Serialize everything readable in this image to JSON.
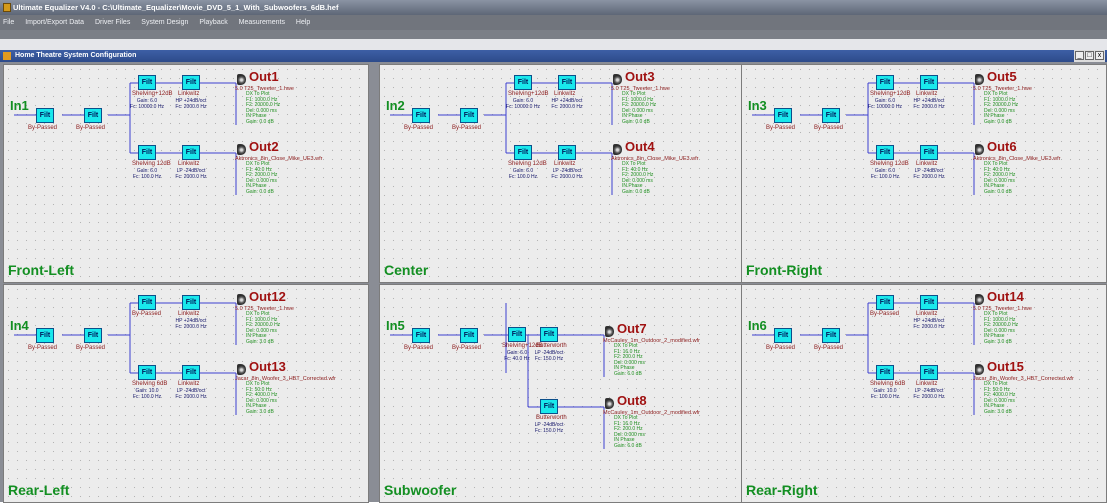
{
  "title_bar": {
    "text": "Ultimate Equalizer V4.0 - C:\\Ultimate_Equalizer\\Movie_DVD_5_1_With_Subwoofers_6dB.hef"
  },
  "menu": [
    "File",
    "Import/Export Data",
    "Driver Files",
    "System Design",
    "Playback",
    "Measurements",
    "Help"
  ],
  "child_window": {
    "title": "Home Theatre System Configuration",
    "buttons": [
      "_",
      "□",
      "x"
    ]
  },
  "colors": {
    "panel_label": "#138f22",
    "filter_box": "#19e8ec",
    "output_label": "#a01212",
    "detail_text": "#1f8f1f"
  },
  "filter_box_label": "Filt",
  "panels": [
    {
      "name": "Front-Left",
      "input": "In1",
      "pre": [
        "By-Passed",
        "By-Passed"
      ],
      "branches": [
        {
          "out": "Out1",
          "file": "5.0 T25_Tweeter_1.hwe",
          "f1": {
            "name": "Shelving+12dB",
            "gain": "Gain: 6.0",
            "fc": "Fc: 10000.0 Hz"
          },
          "f2": {
            "name": "Linkwitz",
            "type": "HP +24dB/oct",
            "fc": "Fc: 2000.0 Hz"
          },
          "details": [
            "DX To Plot",
            "F1: 1000.0 Hz",
            "F2: 20000.0 Hz",
            "Del: 0.000 ms",
            "IN Phase",
            "Gain: 0.0 dB"
          ]
        },
        {
          "out": "Out2",
          "file": "Aktronics_8in_Close_Mike_UE3.wfr",
          "f1": {
            "name": "Shelving 12dB",
            "gain": "Gain: 6.0",
            "fc": "Fc: 100.0 Hz"
          },
          "f2": {
            "name": "Linkwitz",
            "type": "LP -24dB/oct",
            "fc": "Fc: 2000.0 Hz"
          },
          "details": [
            "DX To Plot",
            "F1: 40.0 Hz",
            "F2: 2000.0 Hz",
            "Del: 0.000 ms",
            "IN Phase",
            "Gain: 0.0 dB"
          ]
        }
      ]
    },
    {
      "name": "Center",
      "input": "In2",
      "pre": [
        "By-Passed",
        "By-Passed"
      ],
      "branches": [
        {
          "out": "Out3",
          "file": "5.0 T25_Tweeter_1.hwe",
          "f1": {
            "name": "Shelving+12dB",
            "gain": "Gain: 6.0",
            "fc": "Fc: 10000.0 Hz"
          },
          "f2": {
            "name": "Linkwitz",
            "type": "HP +24dB/oct",
            "fc": "Fc: 2000.0 Hz"
          },
          "details": [
            "DX To Plot",
            "F1: 1000.0 Hz",
            "F2: 20000.0 Hz",
            "Del: 0.000 ms",
            "IN Phase",
            "Gain: 0.0 dB"
          ]
        },
        {
          "out": "Out4",
          "file": "Aktronics_8in_Close_Mike_UE3.wfr",
          "f1": {
            "name": "Shelving 12dB",
            "gain": "Gain: 6.0",
            "fc": "Fc: 100.0 Hz"
          },
          "f2": {
            "name": "Linkwitz",
            "type": "LP -24dB/oct",
            "fc": "Fc: 2000.0 Hz"
          },
          "details": [
            "DX To Plot",
            "F1: 40.0 Hz",
            "F2: 2000.0 Hz",
            "Del: 0.000 ms",
            "IN Phase",
            "Gain: 0.0 dB"
          ]
        }
      ]
    },
    {
      "name": "Front-Right",
      "input": "In3",
      "pre": [
        "By-Passed",
        "By-Passed"
      ],
      "branches": [
        {
          "out": "Out5",
          "file": "5.0 T25_Tweeter_1.hwe",
          "f1": {
            "name": "Shelving+12dB",
            "gain": "Gain: 6.0",
            "fc": "Fc: 10000.0 Hz"
          },
          "f2": {
            "name": "Linkwitz",
            "type": "HP +24dB/oct",
            "fc": "Fc: 2000.0 Hz"
          },
          "details": [
            "DX To Plot",
            "F1: 1000.0 Hz",
            "F2: 20000.0 Hz",
            "Del: 0.000 ms",
            "IN Phase",
            "Gain: 0.0 dB"
          ]
        },
        {
          "out": "Out6",
          "file": "Aktronics_8in_Close_Mike_UE3.wfr",
          "f1": {
            "name": "Shelving 12dB",
            "gain": "Gain: 6.0",
            "fc": "Fc: 100.0 Hz"
          },
          "f2": {
            "name": "Linkwitz",
            "type": "LP -24dB/oct",
            "fc": "Fc: 2000.0 Hz"
          },
          "details": [
            "DX To Plot",
            "F1: 40.0 Hz",
            "F2: 2000.0 Hz",
            "Del: 0.000 ms",
            "IN Phase",
            "Gain: 0.0 dB"
          ]
        }
      ]
    },
    {
      "name": "Rear-Left",
      "input": "In4",
      "pre": [
        "By-Passed",
        "By-Passed"
      ],
      "branches": [
        {
          "out": "Out12",
          "file": "5.0 T25_Tweeter_1.hwe",
          "f1": {
            "name": "By-Passed",
            "gain": "",
            "fc": ""
          },
          "f2": {
            "name": "Linkwitz",
            "type": "HP +24dB/oct",
            "fc": "Fc: 2000.0 Hz"
          },
          "details": [
            "DX To Plot",
            "F1: 1000.0 Hz",
            "F2: 20000.0 Hz",
            "Del: 0.000 ms",
            "IN Phase",
            "Gain: 3.0 dB"
          ]
        },
        {
          "out": "Out13",
          "file": "Jacar_8in_Woofer_3_HBT_Corrected.wfr",
          "f1": {
            "name": "Shelving 6dB",
            "gain": "Gain: 10.0",
            "fc": "Fc: 100.0 Hz"
          },
          "f2": {
            "name": "Linkwitz",
            "type": "LP -24dB/oct",
            "fc": "Fc: 2000.0 Hz"
          },
          "details": [
            "DX To Plot",
            "F1: 50.0 Hz",
            "F2: 4000.0 Hz",
            "Del: 0.000 ms",
            "IN Phase",
            "Gain: 3.0 dB"
          ]
        }
      ]
    },
    {
      "name": "Subwoofer",
      "input": "In5",
      "pre": [
        "By-Passed",
        "By-Passed"
      ],
      "branches": [
        {
          "out": "Out7",
          "file": "McCauley_1m_Outdoor_2_modified.wfr",
          "f1": {
            "name": "Shelving+12dB",
            "gain": "Gain: 6.0",
            "fc": "Fc: 40.0 Hz"
          },
          "f2": {
            "name": "Butterworth",
            "type": "LP -24dB/oct",
            "fc": "Fc: 150.0 Hz"
          },
          "details": [
            "DX To Plot",
            "F1: 16.0 Hz",
            "F2: 200.0 Hz",
            "Del: 0.000 ms",
            "IN Phase",
            "Gain: 6.0 dB"
          ]
        },
        {
          "out": "Out8",
          "file": "McCauley_1m_Outdoor_2_modified.wfr",
          "f1": {
            "name": "",
            "gain": "",
            "fc": ""
          },
          "f2": {
            "name": "Butterworth",
            "type": "LP -24dB/oct",
            "fc": "Fc: 150.0 Hz"
          },
          "details": [
            "DX To Plot",
            "F1: 16.0 Hz",
            "F2: 200.0 Hz",
            "Del: 0.000 ms",
            "IN Phase",
            "Gain: 6.0 dB"
          ]
        }
      ]
    },
    {
      "name": "Rear-Right",
      "input": "In6",
      "pre": [
        "By-Passed",
        "By-Passed"
      ],
      "branches": [
        {
          "out": "Out14",
          "file": "5.0 T25_Tweeter_1.hwe",
          "f1": {
            "name": "By-Passed",
            "gain": "",
            "fc": ""
          },
          "f2": {
            "name": "Linkwitz",
            "type": "HP +24dB/oct",
            "fc": "Fc: 2000.0 Hz"
          },
          "details": [
            "DX To Plot",
            "F1: 1000.0 Hz",
            "F2: 20000.0 Hz",
            "Del: 0.000 ms",
            "IN Phase",
            "Gain: 3.0 dB"
          ]
        },
        {
          "out": "Out15",
          "file": "Jacar_8in_Woofer_3_HBT_Corrected.wfr",
          "f1": {
            "name": "Shelving 6dB",
            "gain": "Gain: 10.0",
            "fc": "Fc: 100.0 Hz"
          },
          "f2": {
            "name": "Linkwitz",
            "type": "LP -24dB/oct",
            "fc": "Fc: 2000.0 Hz"
          },
          "details": [
            "DX To Plot",
            "F1: 50.0 Hz",
            "F2: 4000.0 Hz",
            "Del: 0.000 ms",
            "IN Phase",
            "Gain: 3.0 dB"
          ]
        }
      ]
    }
  ]
}
